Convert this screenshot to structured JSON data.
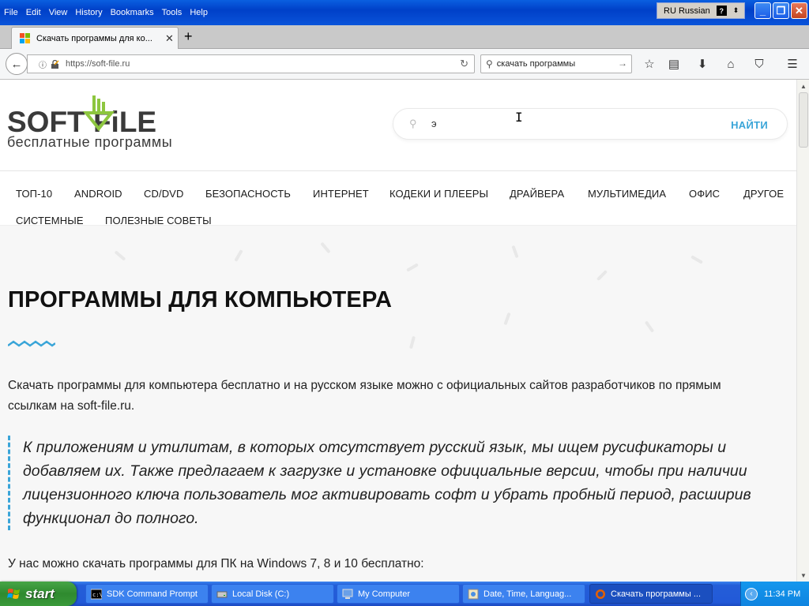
{
  "window": {
    "menu": [
      "File",
      "Edit",
      "View",
      "History",
      "Bookmarks",
      "Tools",
      "Help"
    ],
    "language_bar": "RU Russian",
    "language_help": "?"
  },
  "tabs": [
    {
      "title": "Скачать программы для ко...",
      "active": true
    }
  ],
  "navbar": {
    "url": "https://soft-file.ru",
    "search_value": "скачать программы"
  },
  "site": {
    "logo_word": "SOFT FiLE",
    "logo_tagline": "бесплатные программы",
    "search_value": "э",
    "search_button": "НАЙТИ",
    "categories_row1": [
      "ТОП-10",
      "ANDROID",
      "CD/DVD",
      "БЕЗОПАСНОСТЬ",
      "ИНТЕРНЕТ",
      "КОДЕКИ И ПЛЕЕРЫ",
      "ДРАЙВЕРА",
      "МУЛЬТИМЕДИА",
      "ОФИС",
      "ДРУГОЕ"
    ],
    "categories_row2": [
      "СИСТЕМНЫЕ",
      "ПОЛЕЗНЫЕ СОВЕТЫ"
    ],
    "heading": "ПРОГРАММЫ ДЛЯ КОМПЬЮТЕРА",
    "intro": "Скачать программы для компьютера бесплатно и на русском языке можно с официальных сайтов разработчиков по прямым ссылкам на soft-file.ru.",
    "quote": "К приложениям и утилитам, в которых отсутствует русский язык, мы ищем русификаторы и добавляем их. Также предлагаем к загрузке и установке официальные версии, чтобы при наличии лицензионного ключа пользователь мог активировать софт и убрать пробный период, расширив функционал до полного.",
    "more": "У нас можно скачать программы для ПК на Windows 7, 8 и 10 бесплатно:",
    "accent_color": "#3aa5d8",
    "logo_green": "#8dc63f"
  },
  "taskbar": {
    "start": "start",
    "tasks": [
      {
        "label": "SDK Command Prompt",
        "icon": "cmd-icon"
      },
      {
        "label": "Local Disk (C:)",
        "icon": "drive-icon"
      },
      {
        "label": "My Computer",
        "icon": "computer-icon"
      },
      {
        "label": "Date, Time, Languag...",
        "icon": "control-panel-icon"
      },
      {
        "label": "Скачать программы ...",
        "icon": "firefox-icon",
        "active": true
      }
    ],
    "clock": "11:34 PM"
  }
}
